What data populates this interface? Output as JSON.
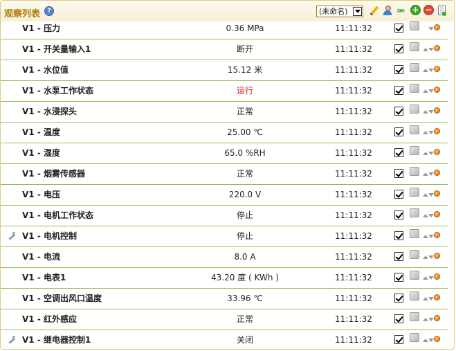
{
  "header": {
    "title": "观察列表",
    "help_icon": "help-icon",
    "selector_value": "(未命名)"
  },
  "toolbar_icons": [
    "pencil-icon",
    "user-icon",
    "forward-icon",
    "add-icon",
    "remove-icon",
    "export-icon"
  ],
  "rows": [
    {
      "name": "V1 - 压力",
      "value": "0.36 MPa",
      "time": "11:11:32",
      "wrench": false,
      "alert": false,
      "up": false
    },
    {
      "name": "V1 - 开关量输入1",
      "value": "断开",
      "time": "11:11:32",
      "wrench": false,
      "alert": false,
      "up": true
    },
    {
      "name": "V1 - 水位值",
      "value": "15.12 米",
      "time": "11:11:32",
      "wrench": false,
      "alert": false,
      "up": true
    },
    {
      "name": "V1 - 水泵工作状态",
      "value": "运行",
      "time": "11:11:32",
      "wrench": false,
      "alert": true,
      "up": true
    },
    {
      "name": "V1 - 水浸探头",
      "value": "正常",
      "time": "11:11:32",
      "wrench": false,
      "alert": false,
      "up": true
    },
    {
      "name": "V1 - 温度",
      "value": "25.00 ℃",
      "time": "11:11:32",
      "wrench": false,
      "alert": false,
      "up": true
    },
    {
      "name": "V1 - 湿度",
      "value": "65.0 %RH",
      "time": "11:11:32",
      "wrench": false,
      "alert": false,
      "up": true
    },
    {
      "name": "V1 - 烟雾传感器",
      "value": "正常",
      "time": "11:11:32",
      "wrench": false,
      "alert": false,
      "up": true
    },
    {
      "name": "V1 - 电压",
      "value": "220.0 V",
      "time": "11:11:32",
      "wrench": false,
      "alert": false,
      "up": true
    },
    {
      "name": "V1 - 电机工作状态",
      "value": "停止",
      "time": "11:11:32",
      "wrench": false,
      "alert": false,
      "up": true
    },
    {
      "name": "V1 - 电机控制",
      "value": "停止",
      "time": "11:11:32",
      "wrench": true,
      "alert": false,
      "up": true
    },
    {
      "name": "V1 - 电流",
      "value": "8.0 A",
      "time": "11:11:32",
      "wrench": false,
      "alert": false,
      "up": true
    },
    {
      "name": "V1 - 电表1",
      "value": "43.20 度 ( KWh )",
      "time": "11:11:32",
      "wrench": false,
      "alert": false,
      "up": true
    },
    {
      "name": "V1 - 空调出风口温度",
      "value": "33.96 ℃",
      "time": "11:11:32",
      "wrench": false,
      "alert": false,
      "up": true
    },
    {
      "name": "V1 - 红外感应",
      "value": "正常",
      "time": "11:11:32",
      "wrench": false,
      "alert": false,
      "up": true
    },
    {
      "name": "V1 - 继电器控制1",
      "value": "关闭",
      "time": "11:11:32",
      "wrench": true,
      "alert": false,
      "up": true
    }
  ]
}
